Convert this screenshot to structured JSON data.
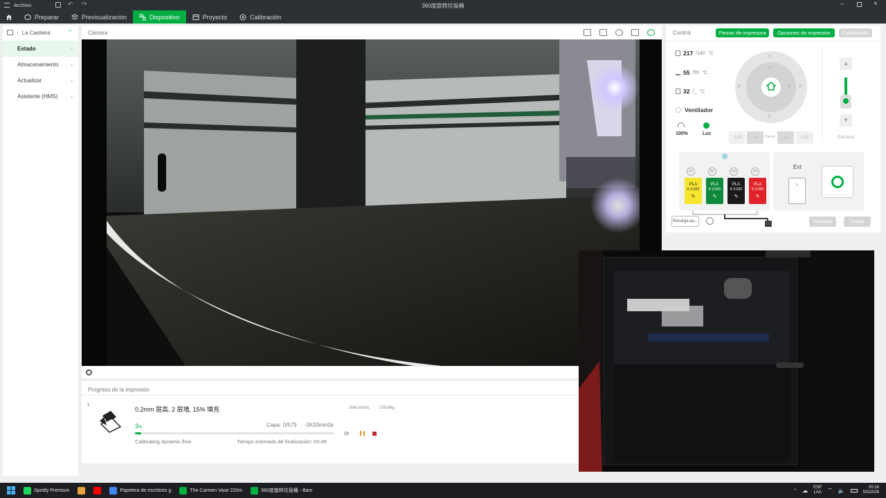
{
  "window": {
    "title": "360度旋转垃圾桶"
  },
  "menu": {
    "file": "Archivo",
    "tabs": [
      {
        "label": "Preparar"
      },
      {
        "label": "Previsualización"
      },
      {
        "label": "Dispositivo"
      },
      {
        "label": "Proyecto"
      },
      {
        "label": "Calibración"
      }
    ]
  },
  "sidebar": {
    "printer": "La Casteira",
    "items": [
      {
        "label": "Estado"
      },
      {
        "label": "Almacenamiento"
      },
      {
        "label": "Actualizar"
      },
      {
        "label": "Asistente (HMS)"
      }
    ]
  },
  "camera": {
    "label": "Cámara"
  },
  "progress": {
    "header": "Progreso de la impresión",
    "plate": "1",
    "job_title": "0.2mm 层高, 2 层墙, 15% 填充",
    "time": "3h41min9s",
    "weight": "109,66g",
    "percent": "3",
    "percent_unit": "%",
    "percent_value": 3,
    "layer": "Capa: 0/579",
    "remaining": "-3h33min0s",
    "status": "Calibrating dynamic flow",
    "eta": "Tiempo estimado de finalización: 03:49"
  },
  "control": {
    "title": "Control",
    "btn_parts": "Piezas de impresora",
    "btn_options": "Opciones de impresión",
    "btn_calibration": "Calibración",
    "nozzle": {
      "current": "217",
      "target": "/140",
      "unit": "°C"
    },
    "bed": {
      "current": "55",
      "target": "/55",
      "unit": "°C"
    },
    "chamber": {
      "current": "32",
      "target": "/_",
      "unit": "°C"
    },
    "fan": "Ventilador",
    "speed": "100%",
    "light": "Luz",
    "jog": {
      "y": "Y",
      "y10": "Y",
      "x": "X",
      "x10": "X",
      "neg_y": "-Y",
      "neg_x": "-X",
      "z_up10": "10",
      "z_up1": "1",
      "z_dn1": "1",
      "z_dn10": "10",
      "z_label": "Cama"
    },
    "extruder": "Extrusor"
  },
  "ams": {
    "slots": [
      {
        "id": "A1",
        "type": "PLA",
        "k": "K 0.020",
        "color": "#f5e52e"
      },
      {
        "id": "A2",
        "type": "PLA",
        "k": "K 0.020",
        "color": "#0f8a3c"
      },
      {
        "id": "A3",
        "type": "PLA",
        "k": "K 0.020",
        "color": "#1a1a1a"
      },
      {
        "id": "A4",
        "type": "PLA",
        "k": "K 0.020",
        "color": "#e0222b"
      }
    ],
    "ext_label": "Ext",
    "ext_slot": "?",
    "btn_auto": "Recarga au...",
    "btn_unload": "Descarga",
    "btn_load": "Cargar"
  },
  "taskbar": {
    "apps": [
      {
        "label": "Spotify Premium",
        "color": "#1ed760"
      },
      {
        "label": "",
        "color": "#e8a33a"
      },
      {
        "label": "",
        "color": "#ff0000"
      },
      {
        "label": "Papelera de escritorio g",
        "color": "#4285f4"
      },
      {
        "label": "The Carmen Vase 220m",
        "color": "#00ae42"
      },
      {
        "label": "360度旋转垃圾桶 - Bam",
        "color": "#00ae42"
      }
    ],
    "lang": "ESP",
    "lang2": "LAA",
    "time": "00:16",
    "date": "5/5/2026"
  },
  "colors": {
    "accent": "#00ae42",
    "titlebar": "#2d3035"
  }
}
